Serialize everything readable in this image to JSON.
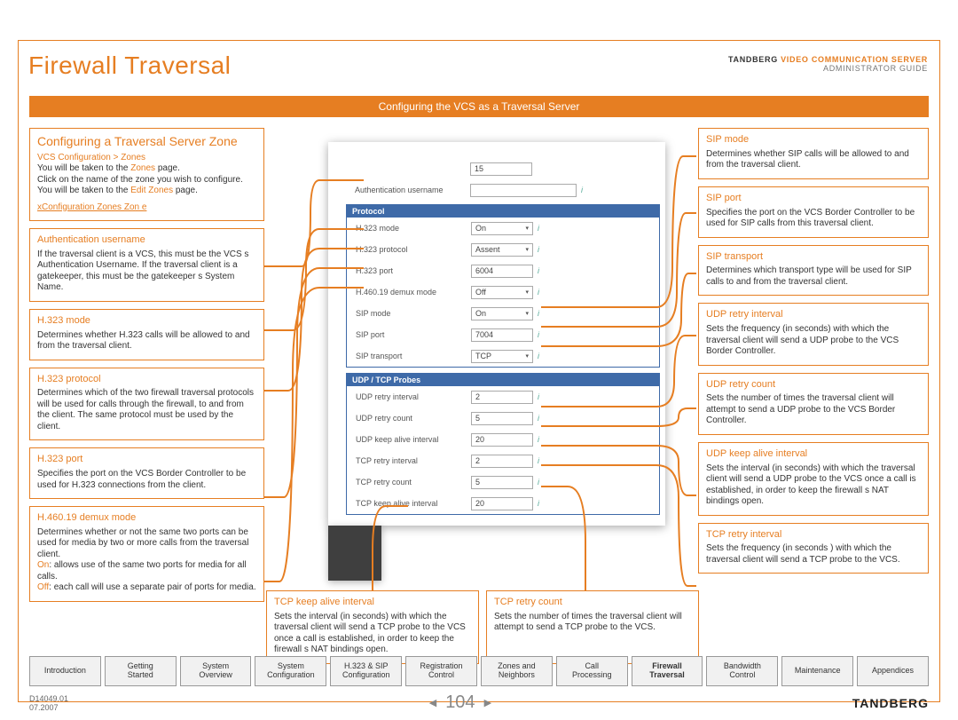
{
  "header": {
    "page_title": "Firewall Traversal",
    "brand_bold": "TANDBERG",
    "brand_orange": " VIDEO COMMUNICATION SERVER",
    "brand_sub": "ADMINISTRATOR GUIDE",
    "orange_bar": "Configuring the VCS as a Traversal Server"
  },
  "left": {
    "zone": {
      "title": "Configuring a Traversal Server Zone",
      "breadcrumb": "VCS Configuration > Zones",
      "p1a": "You will be taken to the ",
      "p1link": "Zones",
      "p1b": " page.",
      "p2": "Click on the name of the zone you wish to configure.",
      "p3a": "You will be taken to the ",
      "p3link": "Edit Zones",
      "p3b": " page.",
      "xconf": "xConfiguration Zones Zon            e"
    },
    "auth": {
      "title": "Authentication username",
      "body": "If the traversal client is a VCS, this must be the VCS s Authentication Username. If the traversal client is a gatekeeper, this must be the gatekeeper s System Name."
    },
    "h323mode": {
      "title": "H.323 mode",
      "body": "Determines whether H.323 calls will be allowed to and from the traversal client."
    },
    "h323proto": {
      "title": "H.323 protocol",
      "body": "Determines which of the two firewall traversal protocols will be used for calls through the firewall, to and from the client.  The same protocol must be used by the client."
    },
    "h323port": {
      "title": "H.323 port",
      "body": "Specifies the port on the VCS Border Controller to be used for H.323 connections from the client."
    },
    "demux": {
      "title": "H.460.19 demux mode",
      "p1": "Determines whether or not the same two ports can be used for media by two or more calls from the traversal client.",
      "on_lbl": "On",
      "on_txt": ": allows use of the same two ports for media for all calls.",
      "off_lbl": "Off",
      "off_txt": ": each call will use a separate pair of ports for media."
    }
  },
  "right": {
    "sipmode": {
      "title": "SIP mode",
      "body": "Determines whether SIP calls will be allowed to and from the traversal client."
    },
    "sipport": {
      "title": "SIP port",
      "body": "Specifies the port on the VCS Border Controller to be used for SIP calls from this traversal client."
    },
    "siptransport": {
      "title": "SIP transport",
      "body": "Determines which transport type will be used for SIP calls to and from the traversal client."
    },
    "udpretry": {
      "title": "UDP retry interval",
      "body": "Sets the frequency (in seconds) with which the traversal client will send a UDP probe to the VCS Border Controller."
    },
    "udpcount": {
      "title": "UDP retry count",
      "body": "Sets the number of times the traversal client will attempt to send a UDP probe to the VCS Border Controller."
    },
    "udpkeep": {
      "title": "UDP keep alive interval",
      "body": "Sets the interval (in seconds) with which the traversal client will send a UDP probe to the VCS once a call is established, in order to keep the firewall s NAT bindings open."
    },
    "tcpretry": {
      "title": "TCP retry interval",
      "body": "Sets the frequency (in seconds ) with which the traversal client will send a TCP probe to the VCS."
    }
  },
  "bottom": {
    "tcpkeep": {
      "title": "TCP keep alive interval",
      "body": "Sets the interval (in seconds) with which the traversal client will send a TCP probe to the VCS once a call is established, in order to keep the firewall s NAT bindings open."
    },
    "tcpcount": {
      "title": "TCP retry count",
      "body": "Sets the number of times the traversal client will attempt to send a TCP probe to the VCS."
    }
  },
  "screenshot": {
    "top_val": "15",
    "auth_lbl": "Authentication username",
    "section1": "Protocol",
    "rows1": [
      {
        "lbl": "H.323 mode",
        "val": "On",
        "sel": true
      },
      {
        "lbl": "H.323 protocol",
        "val": "Assent",
        "sel": true
      },
      {
        "lbl": "H.323 port",
        "val": "6004",
        "sel": false
      },
      {
        "lbl": "H.460.19 demux mode",
        "val": "Off",
        "sel": true
      },
      {
        "lbl": "SIP mode",
        "val": "On",
        "sel": true
      },
      {
        "lbl": "SIP port",
        "val": "7004",
        "sel": false
      },
      {
        "lbl": "SIP transport",
        "val": "TCP",
        "sel": true
      }
    ],
    "section2": "UDP / TCP Probes",
    "rows2": [
      {
        "lbl": "UDP retry interval",
        "val": "2"
      },
      {
        "lbl": "UDP retry count",
        "val": "5"
      },
      {
        "lbl": "UDP keep alive interval",
        "val": "20"
      },
      {
        "lbl": "TCP retry interval",
        "val": "2"
      },
      {
        "lbl": "TCP retry count",
        "val": "5"
      },
      {
        "lbl": "TCP keep alive interval",
        "val": "20"
      }
    ]
  },
  "tabs": [
    "Introduction",
    "Getting\nStarted",
    "System\nOverview",
    "System\nConfiguration",
    "H.323 & SIP\nConfiguration",
    "Registration\nControl",
    "Zones and\nNeighbors",
    "Call\nProcessing",
    "Firewall\nTraversal",
    "Bandwidth\nControl",
    "Maintenance",
    "Appendices"
  ],
  "active_tab": 8,
  "footer": {
    "docnum": "D14049.01",
    "date": "07.2007",
    "page": "104",
    "brand": "TANDBERG"
  }
}
